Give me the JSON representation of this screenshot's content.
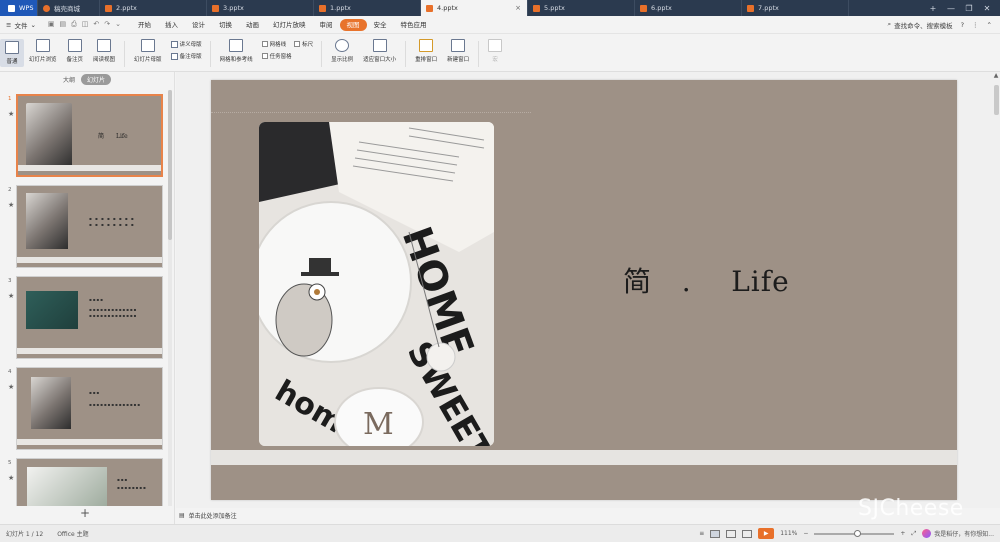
{
  "tabs": [
    {
      "label": "WPS",
      "type": "wps"
    },
    {
      "label": "稿壳商城",
      "type": "home"
    },
    {
      "label": "2.pptx",
      "type": "doc"
    },
    {
      "label": "3.pptx",
      "type": "doc"
    },
    {
      "label": "1.pptx",
      "type": "doc"
    },
    {
      "label": "4.pptx",
      "type": "doc",
      "active": true
    },
    {
      "label": "5.pptx",
      "type": "doc"
    },
    {
      "label": "6.pptx",
      "type": "doc"
    },
    {
      "label": "7.pptx",
      "type": "doc"
    }
  ],
  "tab_close_glyph": "×",
  "tab_new_glyph": "+",
  "window_controls": {
    "minimize": "—",
    "maximize": "❐",
    "close": "✕"
  },
  "menu": {
    "file_label": "文件",
    "items": [
      "开始",
      "插入",
      "设计",
      "切换",
      "动画",
      "幻灯片放映",
      "审阅",
      "视图",
      "安全",
      "特色应用"
    ],
    "active_item": "视图",
    "search_label": "查找命令、搜索模板",
    "help_glyph": "?"
  },
  "ribbon": {
    "normal": "普通",
    "slide_sorter": "幻灯片浏览",
    "notes_page": "备注页",
    "reading_view": "阅读视图",
    "slide_master": "幻灯片母版",
    "handout_master": "讲义母版",
    "notes_master": "备注母版",
    "grid_guides": "网格和参考线",
    "gridlines": "网格线",
    "ruler": "标尺",
    "task_pane": "任务窗格",
    "zoom": "显示比例",
    "fit_window": "适应窗口大小",
    "arrange": "重排窗口",
    "new_window": "新建窗口",
    "macro": "宏"
  },
  "left_panel": {
    "tab_outline": "大纲",
    "tab_slides": "幻灯片",
    "slides": [
      {
        "num": "1",
        "title": "简　　Life"
      },
      {
        "num": "2",
        "title": ""
      },
      {
        "num": "3",
        "title": ""
      },
      {
        "num": "4",
        "title": ""
      },
      {
        "num": "5",
        "title": ""
      }
    ],
    "star": "★",
    "add_glyph": "+"
  },
  "slide": {
    "title": "简   .    Life"
  },
  "notes": {
    "placeholder": "单击此处添加备注"
  },
  "status": {
    "slide_info": "幻灯片 1 / 12",
    "theme": "Office 主题",
    "zoom": "111%",
    "assistant": "我是稻仔，有你想知..."
  },
  "watermark": "SJCheese"
}
